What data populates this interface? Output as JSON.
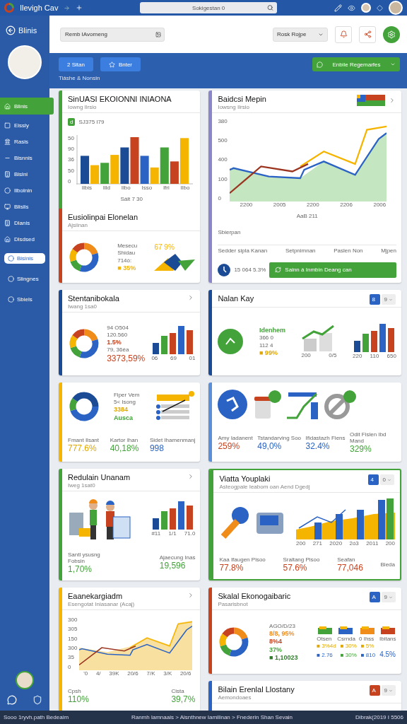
{
  "topbar": {
    "title": "Ilevigh Cav",
    "search": {
      "placeholder": "Sokigestan 0"
    }
  },
  "sidebar": {
    "title": "Blinis",
    "items": [
      {
        "label": "Blinis",
        "selected": true
      },
      {
        "label": "Eissly",
        "selected": false
      },
      {
        "label": "Rasis",
        "selected": false
      },
      {
        "label": "Bisnnis",
        "selected": false
      },
      {
        "label": "Bislni",
        "selected": false
      },
      {
        "label": "Ilbolnin",
        "selected": false
      },
      {
        "label": "Blislis",
        "selected": false
      },
      {
        "label": "Dlanis",
        "selected": false
      },
      {
        "label": "Dlsdsed",
        "selected": false
      }
    ],
    "shortcuts": [
      {
        "label": "Bisinis",
        "kind": "pill"
      },
      {
        "label": "Slingnes",
        "kind": "plain"
      },
      {
        "label": "Sbiels",
        "kind": "plain"
      }
    ]
  },
  "header": {
    "field": {
      "value": "Remb IAvorneng"
    },
    "select": {
      "value": "Rosk Rojpe"
    }
  },
  "band": {
    "buttons": [
      "2 Sitan",
      "Bnter"
    ],
    "note": "Tiáshe & Nonsin",
    "action": "Enbile Regemarfes"
  },
  "columns": [
    [
      {
        "highlighted": false,
        "sections": [
          {
            "color": "#43a33a",
            "title": "SinUASI EKOIONNI INIAONA",
            "subtitle": "Iowng Ilrsio",
            "rows": [
              [
                {
                  "kind": "tag",
                  "badge": "d",
                  "text": "SJ375 I79"
                }
              ],
              [
                {
                  "kind": "bars",
                  "yticks": [
                    "50",
                    "90",
                    "36",
                    "50",
                    "0"
                  ],
                  "xlabels": [
                    "Ilbis",
                    "Illd",
                    "Ilbo",
                    "Isso",
                    "Ifri",
                    "Ilbo"
                  ],
                  "caption": "Sált 7 30"
                }
              ]
            ]
          },
          {
            "color": "#c7431f",
            "title": "Eusiolinpai Elonelan",
            "subtitle": "Ajsiinan",
            "rows": [
              [
                {
                  "kind": "donut"
                },
                {
                  "kind": "lines",
                  "items": [
                    {
                      "text": "Mesecu"
                    },
                    {
                      "text": "Shidau"
                    },
                    {
                      "text": "714ó:"
                    },
                    {
                      "text": "■ 35%",
                      "color": "#f5b400"
                    }
                  ]
                },
                {
                  "kind": "shapes",
                  "value": "67 9%"
                }
              ]
            ]
          }
        ]
      },
      {
        "highlighted": false,
        "sections": [
          {
            "color": "#1b4b94",
            "title": "Stentanibokala",
            "subtitle": "Iwang 1sa0",
            "control": {
              "kind": "chevron"
            },
            "rows": [
              [
                {
                  "kind": "donut"
                },
                {
                  "kind": "lines",
                  "items": [
                    {
                      "text": "94 O504"
                    },
                    {
                      "text": "120.560"
                    },
                    {
                      "text": "1.5%",
                      "color": "#c7431f"
                    },
                    {
                      "text": "79, 36éa"
                    }
                  ],
                  "total": {
                    "text": "3373,59%",
                    "color": "#c7431f"
                  }
                },
                {
                  "kind": "minibars",
                  "xlabels": [
                    "06",
                    "69",
                    "01"
                  ]
                }
              ]
            ]
          }
        ]
      },
      {
        "highlighted": false,
        "sections": [
          {
            "color": "#f5b400",
            "rows": [
              [
                {
                  "kind": "ring"
                },
                {
                  "kind": "lines",
                  "items": [
                    {
                      "text": "Fiper Vem"
                    },
                    {
                      "text": "5< Isong"
                    },
                    {
                      "text": "3384",
                      "color": "#e0a800"
                    },
                    {
                      "text": "Ausca",
                      "color": "#43a33a"
                    }
                  ]
                },
                {
                  "kind": "flow"
                }
              ],
              [
                {
                  "kind": "stat",
                  "label": "Fmant Ilsant",
                  "value": "777.6%",
                  "color": "#e0a800"
                },
                {
                  "kind": "stat",
                  "label": "Kartor Ihan",
                  "value": "40,18%",
                  "color": "#43a33a"
                },
                {
                  "kind": "stat",
                  "label": "Sidet Ihamenmanj",
                  "value": "998",
                  "color": "#2a63c4"
                }
              ]
            ]
          }
        ]
      },
      {
        "highlighted": false,
        "sections": [
          {
            "color": "#43a33a",
            "title": "Redulain Unanam",
            "subtitle": "Iweg 1sat0",
            "control": {
              "kind": "chevron"
            },
            "rows": [
              [
                {
                  "kind": "people"
                },
                {
                  "kind": "minibars",
                  "xlabels": [
                    "#11",
                    "1/1",
                    "71.0"
                  ]
                }
              ],
              [
                {
                  "kind": "stat",
                  "label": "Santl ysusng Fobsin",
                  "value": "1,70%",
                  "color": "#43a33a"
                },
                {
                  "kind": "stat",
                  "label": "Ajaecung Inas",
                  "value": "19,596",
                  "color": "#43a33a"
                }
              ]
            ]
          }
        ]
      },
      {
        "highlighted": false,
        "sections": [
          {
            "color": "#f5b400",
            "title": "Eaanekargiadm",
            "subtitle": "Esengotat Iniasanar (Acaj)",
            "control": {
              "kind": "chevron"
            },
            "rows": [
              [
                {
                  "kind": "area",
                  "yticks": [
                    "300",
                    "305",
                    "150",
                    "300",
                    "35",
                    "0"
                  ],
                  "xticks": [
                    "'0",
                    "4/",
                    "39K",
                    "20/6",
                    "7/K",
                    "3/K",
                    "20/6"
                  ]
                }
              ],
              [
                {
                  "kind": "stat",
                  "label": "Cpsh",
                  "value": "110%",
                  "color": "#43a33a"
                },
                {
                  "kind": "stat",
                  "label": "Cista",
                  "value": "39,7%",
                  "color": "#43a33a"
                }
              ]
            ]
          }
        ]
      }
    ],
    [
      {
        "highlighted": false,
        "sections": [
          {
            "color": "#8a86c9",
            "title": "Baidcsi Mepin",
            "subtitle": "Iowsng Ilrsio",
            "control": {
              "kind": "legend"
            },
            "rows": [
              [
                {
                  "kind": "line",
                  "yticks": [
                    "380",
                    "500",
                    "400",
                    "100",
                    "0"
                  ],
                  "xticks": [
                    "2200",
                    "2005",
                    "2200",
                    "2206",
                    "2006"
                  ],
                  "caption": "AaB 211"
                }
              ],
              [
                {
                  "kind": "note",
                  "text": "Sbierpan"
                }
              ],
              [
                {
                  "kind": "columns",
                  "items": [
                    "Sedder sipla Kanan",
                    "Setpnimnan",
                    "Paslen Non",
                    "Mjpen"
                  ]
                }
              ],
              [
                {
                  "kind": "figure",
                  "text": "15 064 5.3%"
                },
                {
                  "kind": "action",
                  "text": "Sainn á Inmbin Deang can"
                }
              ]
            ]
          }
        ]
      },
      {
        "highlighted": false,
        "sections": [
          {
            "color": "#1b4b94",
            "title": "Nalan Kay",
            "control": {
              "kind": "toggle",
              "options": [
                {
                  "label": "8",
                  "selected": true
                },
                {
                  "label": "9",
                  "selected": false
                }
              ]
            },
            "rows": [
              [
                {
                  "kind": "disc"
                },
                {
                  "kind": "lines",
                  "items": [
                    {
                      "text": "Idenhem",
                      "color": "#43a33a"
                    },
                    {
                      "text": "366 0"
                    },
                    {
                      "text": "112 4"
                    },
                    {
                      "text": "■ 99%",
                      "color": "#e0a800"
                    }
                  ]
                },
                {
                  "kind": "cylinders",
                  "xlabels": [
                    "200",
                    "0/5"
                  ]
                },
                {
                  "kind": "minibars",
                  "xlabels": [
                    "220",
                    "110",
                    "650"
                  ]
                }
              ]
            ]
          }
        ]
      },
      {
        "highlighted": false,
        "sections": [
          {
            "color": "#5b8fd8",
            "rows": [
              [
                {
                  "kind": "pictograms"
                }
              ],
              [
                {
                  "kind": "stat",
                  "label": "Amy Iadanent",
                  "value": "259%",
                  "color": "#c7431f"
                },
                {
                  "kind": "stat",
                  "label": "Tstandarving Soo",
                  "value": "49,0%",
                  "color": "#2a63c4"
                },
                {
                  "kind": "stat",
                  "label": "Ifidastazh Fiens",
                  "value": "32.4%",
                  "color": "#2a63c4"
                },
                {
                  "kind": "stat",
                  "label": "Odit Fislen Ibd Mand",
                  "value": "329%",
                  "color": "#43a33a"
                }
              ]
            ]
          }
        ]
      },
      {
        "highlighted": true,
        "sections": [
          {
            "color": "#43a33a",
            "title": "Viatta Youplaki",
            "subtitle": "Asteogpale Ieabom oan Aend Dgedj",
            "control": {
              "kind": "toggle",
              "options": [
                {
                  "label": "4",
                  "selected": true
                },
                {
                  "label": "0",
                  "selected": false
                }
              ]
            },
            "rows": [
              [
                {
                  "kind": "devices"
                },
                {
                  "kind": "combo",
                  "xlabels": [
                    "200",
                    "271",
                    "2020",
                    "2ó3",
                    "2011",
                    "200"
                  ]
                }
              ],
              [
                {
                  "kind": "stat",
                  "label": "Kaa Ifaugen Pisoo",
                  "value": "77.8%",
                  "color": "#c7431f"
                },
                {
                  "kind": "stat",
                  "label": "Sraltang Pisoo",
                  "value": "57.6%",
                  "color": "#c7431f"
                },
                {
                  "kind": "stat",
                  "label": "Seafan",
                  "value": "77,046",
                  "color": "#c7431f"
                },
                {
                  "kind": "note",
                  "text": "Bleda"
                }
              ]
            ]
          }
        ]
      },
      {
        "highlighted": false,
        "sections": [
          {
            "color": "#c7431f",
            "title": "Skalal Ekonogaibaric",
            "subtitle": "Pasarisbnot",
            "control": {
              "kind": "toggle",
              "options": [
                {
                  "label": "A",
                  "selected": true
                },
                {
                  "label": "9",
                  "selected": false
                }
              ]
            },
            "rows": [
              [
                {
                  "kind": "donut"
                },
                {
                  "kind": "lines",
                  "items": [
                    {
                      "text": "AGO/D/23"
                    },
                    {
                      "text": "8/8, 95%",
                      "color": "#f08c1a"
                    },
                    {
                      "text": "8%4",
                      "color": "#c7431f"
                    },
                    {
                      "text": "37%",
                      "color": "#43a33a"
                    },
                    {
                      "text": "■ 1,10023",
                      "color": "#2f7d2a"
                    }
                  ]
                },
                {
                  "kind": "legendgrid",
                  "labels": [
                    "Otsen",
                    "Csrnda",
                    "0 Ihss",
                    "Ibitans"
                  ],
                  "items": [
                    {
                      "text": "■ 3%4d",
                      "color": "#e0a800"
                    },
                    {
                      "text": "■ 30%",
                      "color": "#e0a800"
                    },
                    {
                      "text": "■ 5%",
                      "color": "#e0a800"
                    },
                    {
                      "text": "■ 2.76",
                      "color": "#2a63c4"
                    },
                    {
                      "text": "■ 30%",
                      "color": "#43a33a"
                    },
                    {
                      "text": "■ 810",
                      "color": "#2a63c4"
                    }
                  ],
                  "total": "4.5%"
                }
              ]
            ]
          }
        ]
      },
      {
        "highlighted": false,
        "sections": [
          {
            "color": "#2a63c4",
            "title": "Bilain Erenlal Llostany",
            "subtitle": "Aemondoaes",
            "control": {
              "kind": "alert",
              "options": [
                {
                  "label": "A",
                  "selected": true
                },
                {
                  "label": "9",
                  "selected": false
                }
              ]
            }
          }
        ]
      }
    ]
  ],
  "footer": {
    "left": "Sooo 1ryvh.path Bedeaim",
    "center": "Ranmh lamnaais > Aisnthnew Iamilinan > Fnederin Shan Sevain",
    "right": "Dibrak(2019 I 5506"
  }
}
